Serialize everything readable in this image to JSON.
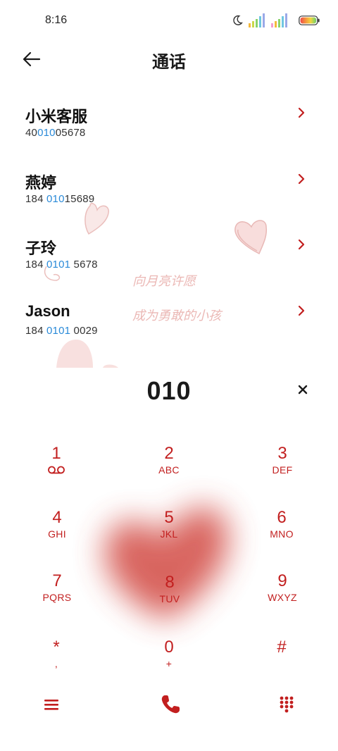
{
  "status_bar": {
    "time": "8:16",
    "icons": [
      "moon-icon",
      "signal-icon",
      "signal-icon",
      "battery-icon"
    ]
  },
  "header": {
    "title": "通话",
    "back_icon": "back-arrow-icon"
  },
  "results": [
    {
      "name": "小米客服",
      "number_pre": "40",
      "number_hl": "010",
      "number_post": "05678"
    },
    {
      "name": "燕婷",
      "number_pre": "184 ",
      "number_hl": "010",
      "number_post": "15689"
    },
    {
      "name": "子玲",
      "number_pre": "184 ",
      "number_hl": "0101",
      "number_post": " 5678"
    },
    {
      "name": "Jason",
      "number_pre": "184 ",
      "number_hl": "0101",
      "number_post": " 0029"
    }
  ],
  "wallpaper_text": [
    "向月亮许愿",
    "成为勇敢的小孩"
  ],
  "dial": {
    "number": "010"
  },
  "keypad": [
    {
      "digit": "1",
      "letters": ""
    },
    {
      "digit": "2",
      "letters": "ABC"
    },
    {
      "digit": "3",
      "letters": "DEF"
    },
    {
      "digit": "4",
      "letters": "GHI"
    },
    {
      "digit": "5",
      "letters": "JKL"
    },
    {
      "digit": "6",
      "letters": "MNO"
    },
    {
      "digit": "7",
      "letters": "PQRS"
    },
    {
      "digit": "8",
      "letters": "TUV"
    },
    {
      "digit": "9",
      "letters": "WXYZ"
    },
    {
      "digit": "*",
      "letters": ","
    },
    {
      "digit": "0",
      "letters": "+"
    },
    {
      "digit": "#",
      "letters": ""
    }
  ],
  "colors": {
    "accent": "#c21f1f",
    "highlight": "#2a8ad8",
    "text": "#1a1a1a"
  }
}
